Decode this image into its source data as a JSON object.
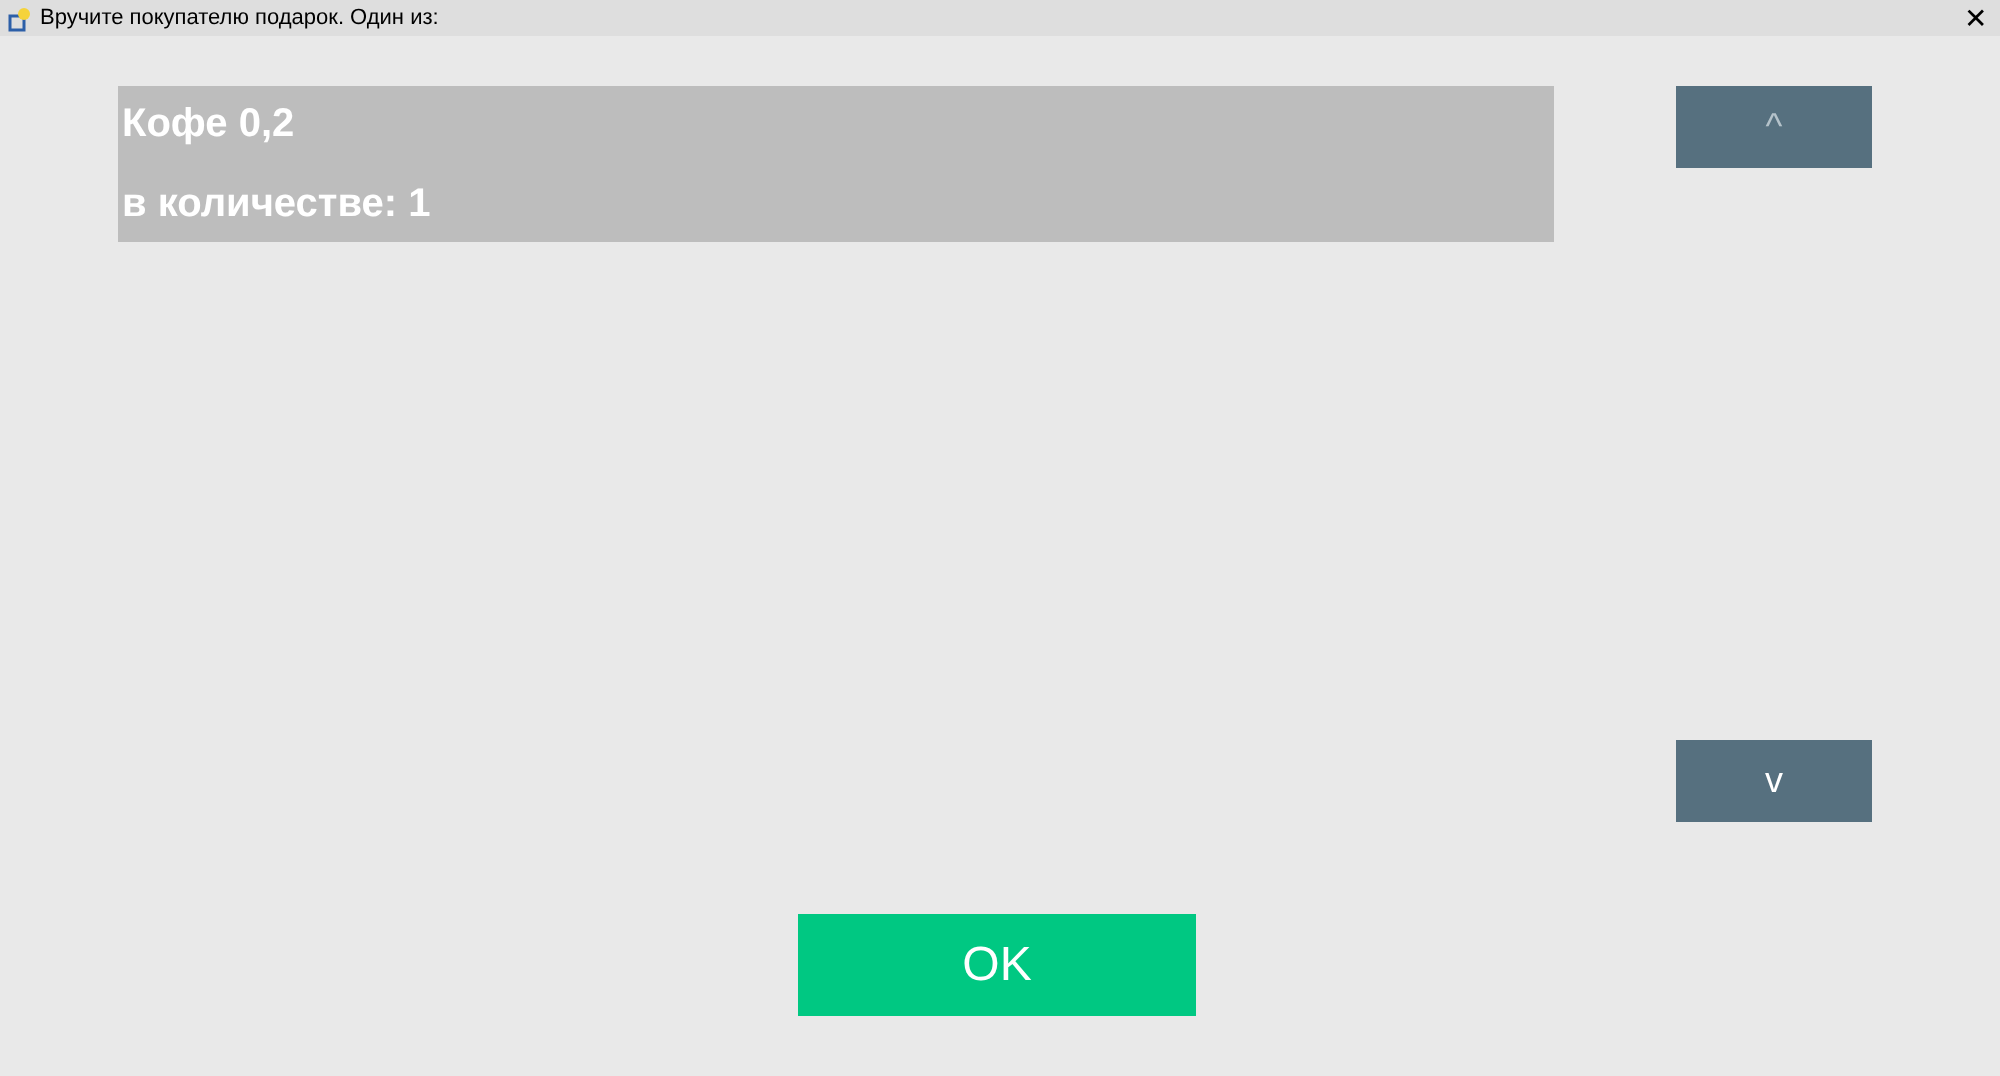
{
  "window": {
    "title": "Вручите покупателю подарок. Один из:",
    "close": "✕"
  },
  "items": [
    {
      "name": "Кофе 0,2",
      "quantity": "в количестве: 1",
      "selected": true
    }
  ],
  "scroll_up": {
    "label": "^",
    "disabled": true
  },
  "scroll_down": {
    "label": "v",
    "disabled": false
  },
  "ok_button": "OK"
}
